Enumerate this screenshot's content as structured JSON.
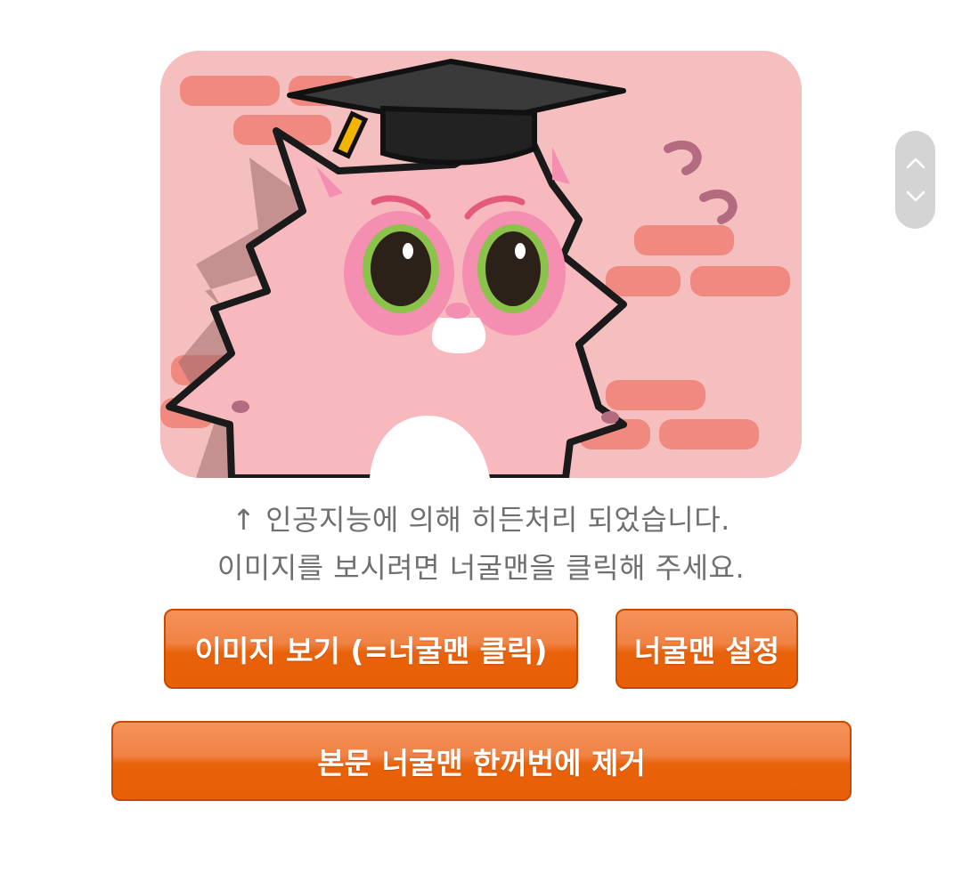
{
  "image": {
    "description_icon": "pink-cat-graduation-cap-illustration"
  },
  "notice": {
    "line1": "↑ 인공지능에 의해 히든처리 되었습니다.",
    "line2": "이미지를 보시려면 너굴맨을 클릭해 주세요."
  },
  "buttons": {
    "view_image": "이미지 보기 (=너굴맨 클릭)",
    "settings": "너굴맨 설정",
    "remove_all": "본문 너굴맨 한꺼번에 제거"
  },
  "scroll": {
    "up_icon": "chevron-up-icon",
    "down_icon": "chevron-down-icon"
  },
  "colors": {
    "button_orange": "#e8620a",
    "card_pink": "#f6bfbf",
    "brick": "#f08a80",
    "text_gray": "#6f6f6f"
  }
}
